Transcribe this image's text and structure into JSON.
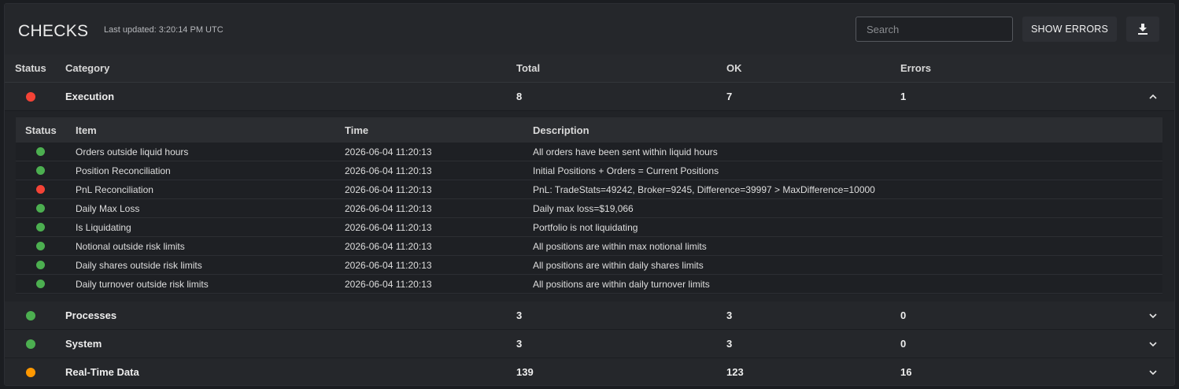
{
  "header": {
    "title": "CHECKS",
    "last_updated": "Last updated: 3:20:14 PM UTC",
    "search_placeholder": "Search",
    "show_errors_label": "SHOW ERRORS",
    "download_icon": "download-icon"
  },
  "colors": {
    "ok": "#4caf50",
    "error": "#f44336",
    "warning": "#ff9800"
  },
  "columns": {
    "status": "Status",
    "category": "Category",
    "total": "Total",
    "ok": "OK",
    "errors": "Errors"
  },
  "categories": [
    {
      "status": "error",
      "name": "Execution",
      "total": "8",
      "ok": "7",
      "errors": "1",
      "expanded": true
    },
    {
      "status": "ok",
      "name": "Processes",
      "total": "3",
      "ok": "3",
      "errors": "0",
      "expanded": false
    },
    {
      "status": "ok",
      "name": "System",
      "total": "3",
      "ok": "3",
      "errors": "0",
      "expanded": false
    },
    {
      "status": "warning",
      "name": "Real-Time Data",
      "total": "139",
      "ok": "123",
      "errors": "16",
      "expanded": false
    }
  ],
  "detail_columns": {
    "status": "Status",
    "item": "Item",
    "time": "Time",
    "description": "Description"
  },
  "execution_items": [
    {
      "status": "ok",
      "item": "Orders outside liquid hours",
      "time": "2026-06-04 11:20:13",
      "description": "All orders have been sent within liquid hours"
    },
    {
      "status": "ok",
      "item": "Position Reconciliation",
      "time": "2026-06-04 11:20:13",
      "description": "Initial Positions + Orders = Current Positions"
    },
    {
      "status": "error",
      "item": "PnL Reconciliation",
      "time": "2026-06-04 11:20:13",
      "description": "PnL: TradeStats=49242, Broker=9245, Difference=39997 > MaxDifference=10000"
    },
    {
      "status": "ok",
      "item": "Daily Max Loss",
      "time": "2026-06-04 11:20:13",
      "description": "Daily max loss=$19,066"
    },
    {
      "status": "ok",
      "item": "Is Liquidating",
      "time": "2026-06-04 11:20:13",
      "description": "Portfolio is not liquidating"
    },
    {
      "status": "ok",
      "item": "Notional outside risk limits",
      "time": "2026-06-04 11:20:13",
      "description": "All positions are within max notional limits"
    },
    {
      "status": "ok",
      "item": "Daily shares outside risk limits",
      "time": "2026-06-04 11:20:13",
      "description": "All positions are within daily shares limits"
    },
    {
      "status": "ok",
      "item": "Daily turnover outside risk limits",
      "time": "2026-06-04 11:20:13",
      "description": "All positions are within daily turnover limits"
    }
  ]
}
